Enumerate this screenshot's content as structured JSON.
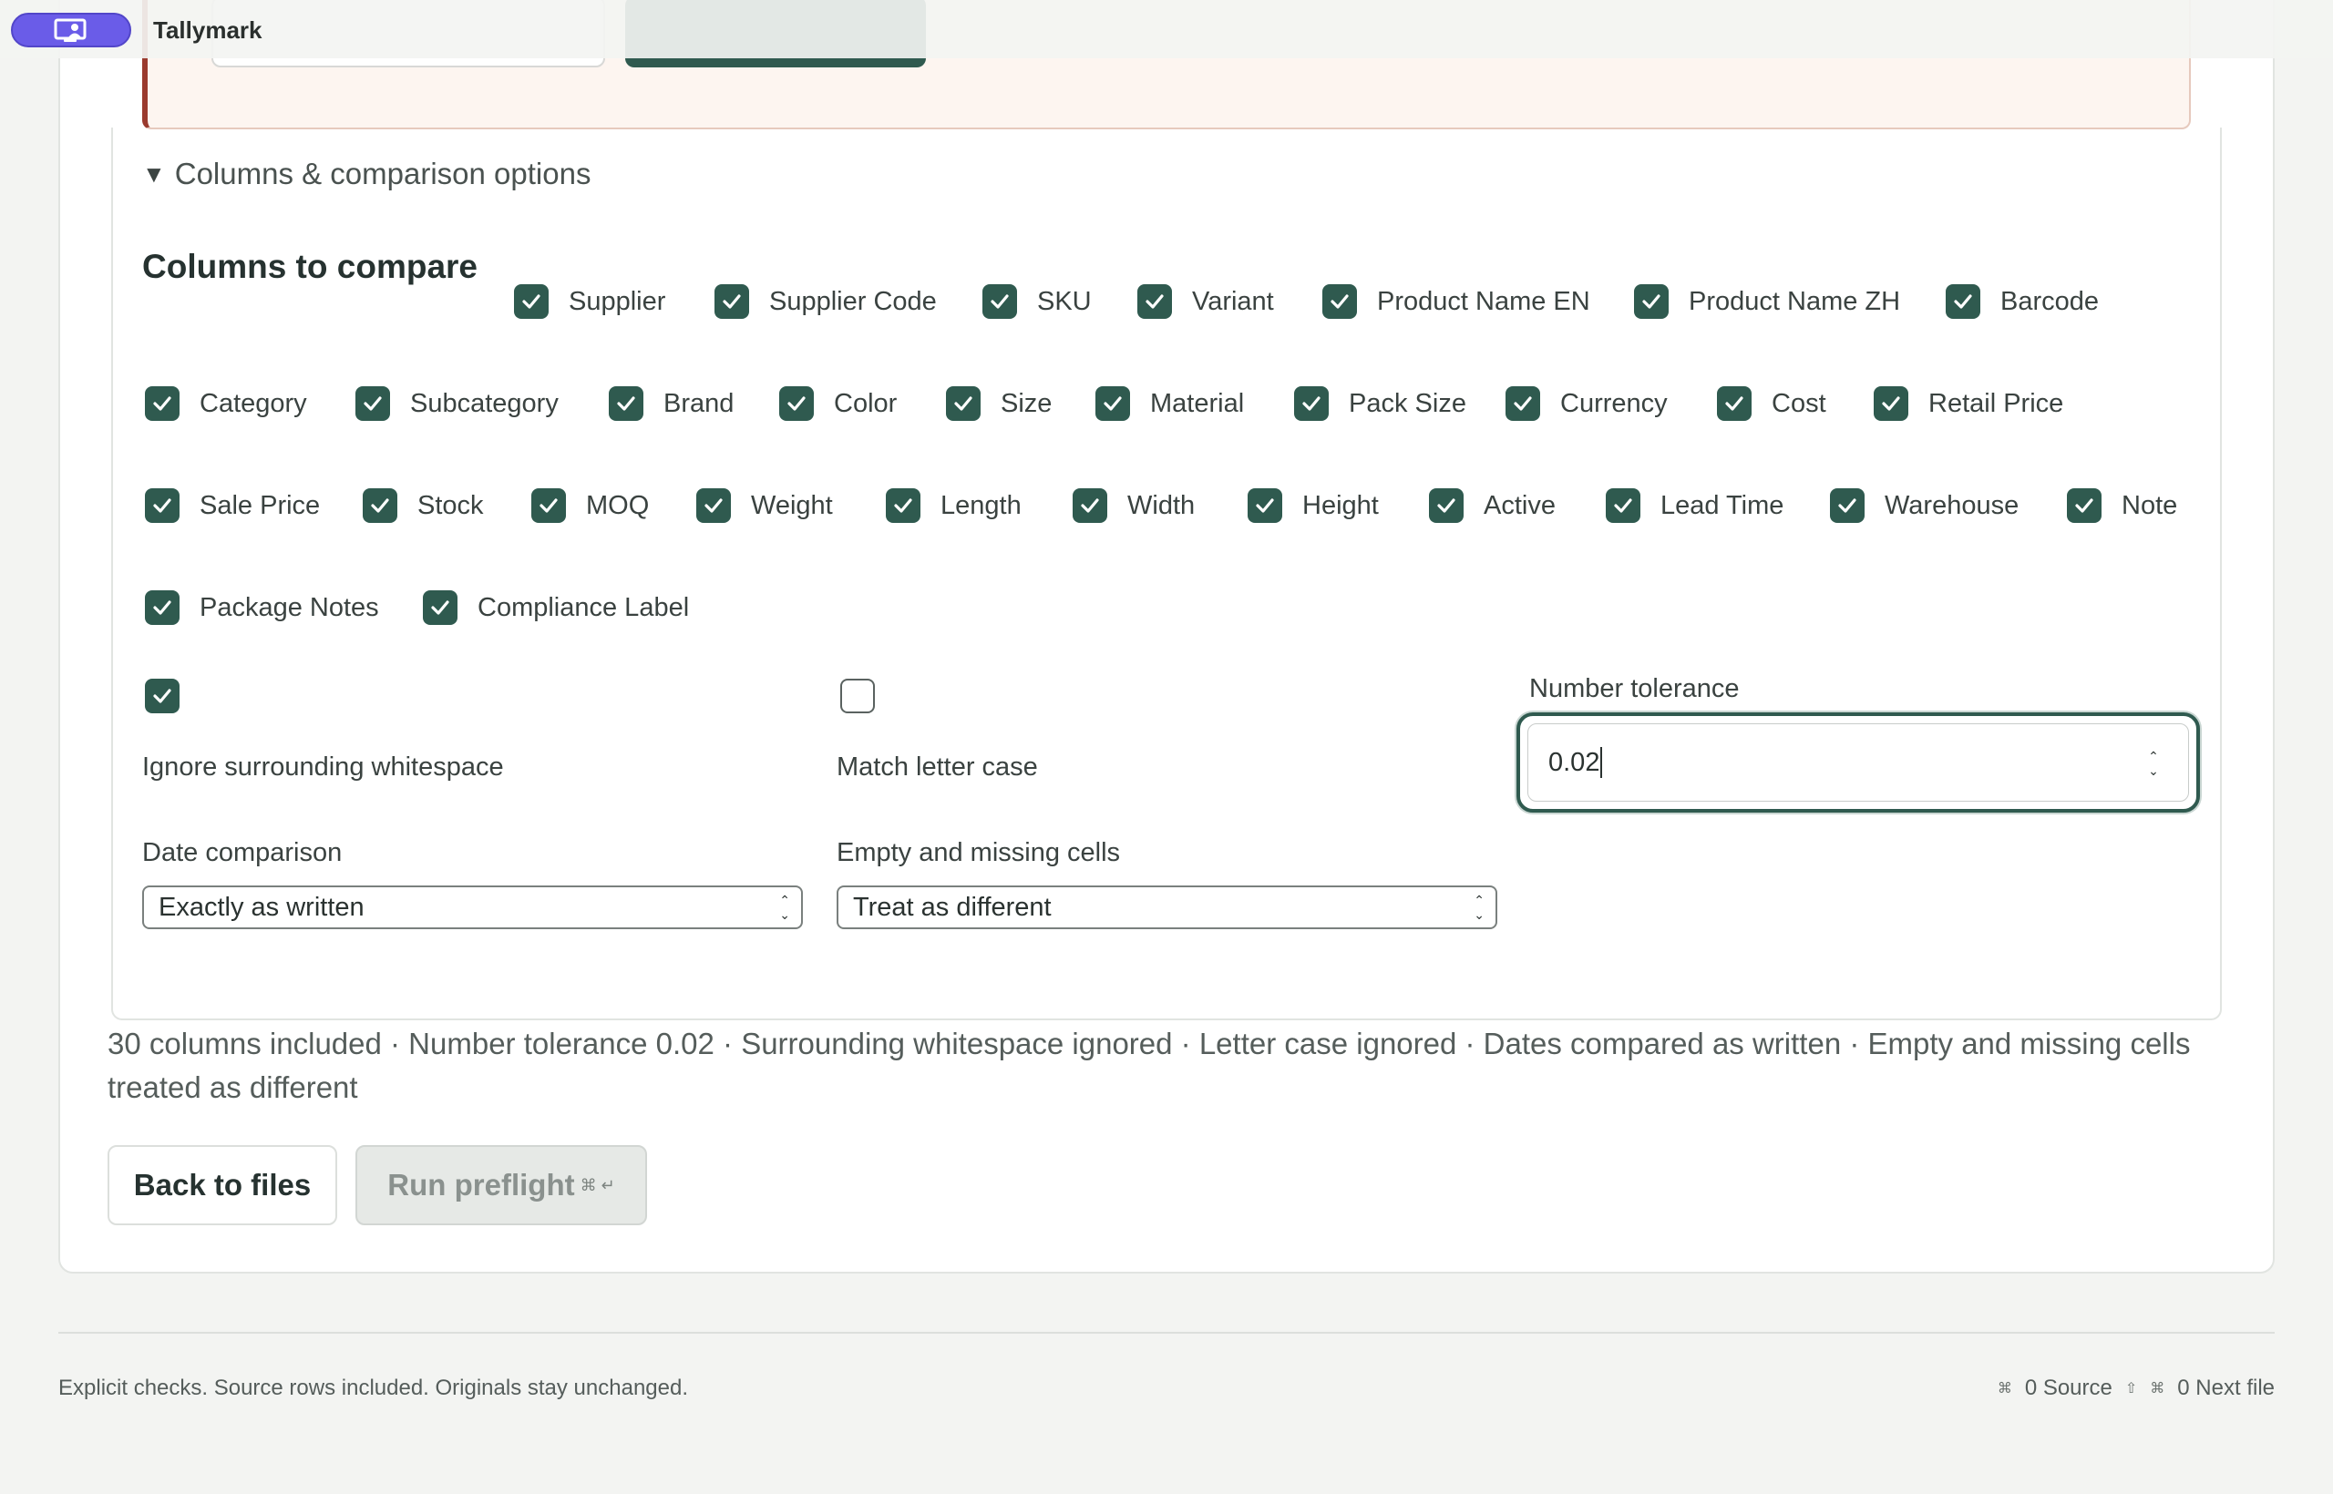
{
  "app": {
    "title": "Tallymark"
  },
  "options_section": {
    "toggle_label": "Columns & comparison options",
    "columns_heading": "Columns to compare"
  },
  "columns": [
    "Supplier",
    "Supplier Code",
    "SKU",
    "Variant",
    "Product Name EN",
    "Product Name ZH",
    "Barcode",
    "Category",
    "Subcategory",
    "Brand",
    "Color",
    "Size",
    "Material",
    "Pack Size",
    "Currency",
    "Cost",
    "Retail Price",
    "Sale Price",
    "Stock",
    "MOQ",
    "Weight",
    "Length",
    "Width",
    "Height",
    "Active",
    "Lead Time",
    "Warehouse",
    "Note",
    "Package Notes",
    "Compliance Label"
  ],
  "options": {
    "ignore_whitespace": {
      "label": "Ignore surrounding whitespace",
      "checked": true
    },
    "match_case": {
      "label": "Match letter case",
      "checked": false
    },
    "number_tolerance": {
      "label": "Number tolerance",
      "value": "0.02"
    },
    "date_comparison": {
      "label": "Date comparison",
      "value": "Exactly as written"
    },
    "empty_cells": {
      "label": "Empty and missing cells",
      "value": "Treat as different"
    }
  },
  "summary": "30 columns included · Number tolerance 0.02 · Surrounding whitespace ignored · Letter case ignored · Dates compared as written · Empty and missing cells treated as different",
  "actions": {
    "back_label": "Back to files",
    "run_label": "Run preflight",
    "run_shortcut": "⌘ ↵"
  },
  "footer": {
    "left": "Explicit checks. Source rows included. Originals stay unchanged.",
    "source_shortcut": "0 Source",
    "next_shortcut": "0 Next file"
  }
}
